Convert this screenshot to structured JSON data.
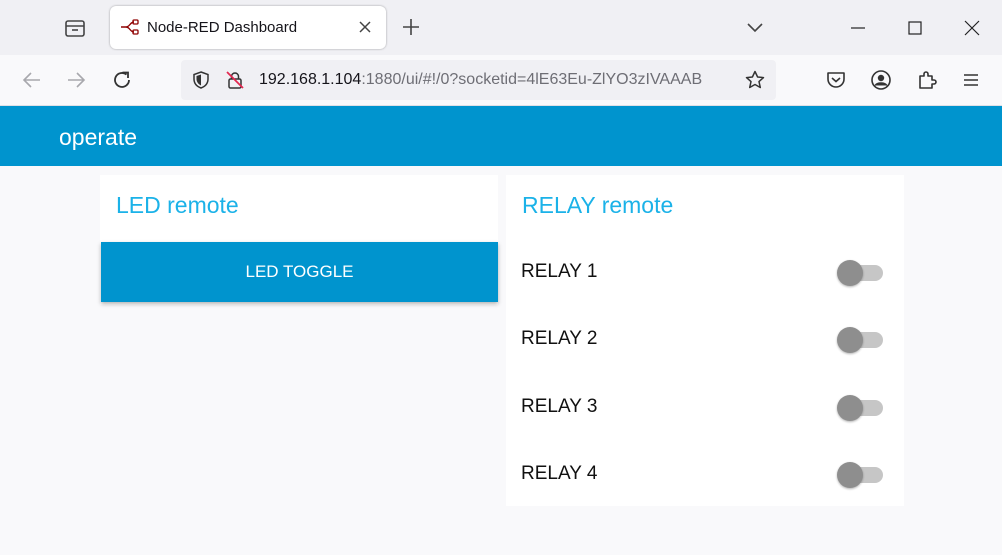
{
  "browser": {
    "tab": {
      "title": "Node-RED Dashboard"
    },
    "url": {
      "host": "192.168.1.104",
      "rest": ":1880/ui/#!/0?socketid=4lE63Eu-ZlYO3zIVAAAB"
    }
  },
  "dashboard": {
    "title": "operate",
    "led_card": {
      "title": "LED remote",
      "button_label": "LED TOGGLE"
    },
    "relay_card": {
      "title": "RELAY remote",
      "relays": [
        {
          "label": "RELAY 1",
          "on": false
        },
        {
          "label": "RELAY 2",
          "on": false
        },
        {
          "label": "RELAY 3",
          "on": false
        },
        {
          "label": "RELAY 4",
          "on": false
        }
      ]
    }
  },
  "colors": {
    "accent": "#0094ce",
    "card_title": "#1bb2e8",
    "switch_off_thumb": "#8e8e8e",
    "switch_off_track": "#c6c6c6"
  }
}
